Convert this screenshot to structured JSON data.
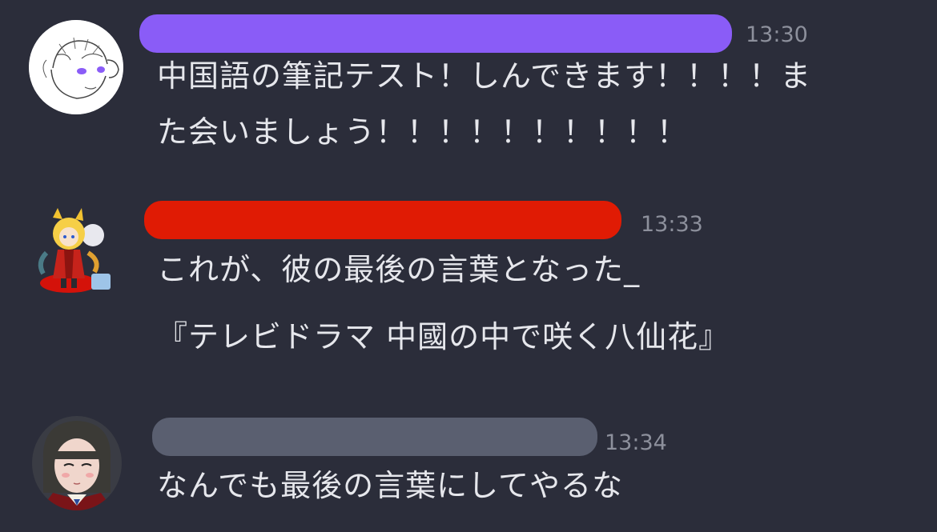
{
  "colors": {
    "background": "#2b2d3a",
    "user1_name_bar": "#8a5cf7",
    "user2_name_bar": "#e01b04",
    "user3_name_bar": "#5a5f70",
    "timestamp": "#8d909c",
    "message_text": "#e6e7ec"
  },
  "messages": [
    {
      "avatar_icon": "sketch-character-avatar",
      "time": "13:30",
      "lines": [
        "中国語の筆記テスト！しんできます！！！！ま",
        "た会いましょう！！！！！！！！！！"
      ]
    },
    {
      "avatar_icon": "fox-girl-character-avatar",
      "time": "13:33",
      "lines": [
        "これが、彼の最後の言葉となった_",
        "『テレビドラマ 中國の中で咲く八仙花』"
      ]
    },
    {
      "avatar_icon": "dark-hair-character-avatar",
      "time": "13:34",
      "lines": [
        "なんでも最後の言葉にしてやるな"
      ]
    }
  ]
}
